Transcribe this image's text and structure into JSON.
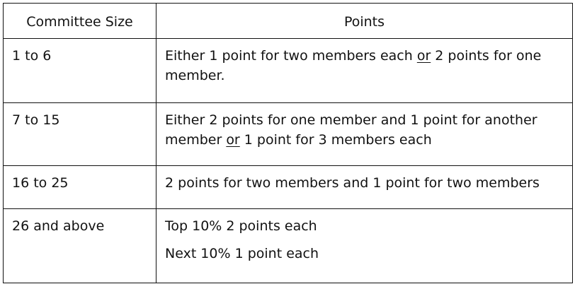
{
  "headers": {
    "col1": "Committee Size",
    "col2": "Points"
  },
  "rows": [
    {
      "size": "1 to 6",
      "points_pre": "Either 1 point for two members each ",
      "points_or": "or",
      "points_post": " 2 points for one member."
    },
    {
      "size": "7 to 15",
      "points_pre": "Either 2 points for one member and 1 point for another member ",
      "points_or": "or",
      "points_post": " 1 point for 3 members each"
    },
    {
      "size": "16 to 25",
      "points": "2 points for two members and 1 point for two members"
    },
    {
      "size": "26 and above",
      "points_line1": "Top 10% 2 points each",
      "points_line2": "Next 10% 1 point each"
    }
  ]
}
